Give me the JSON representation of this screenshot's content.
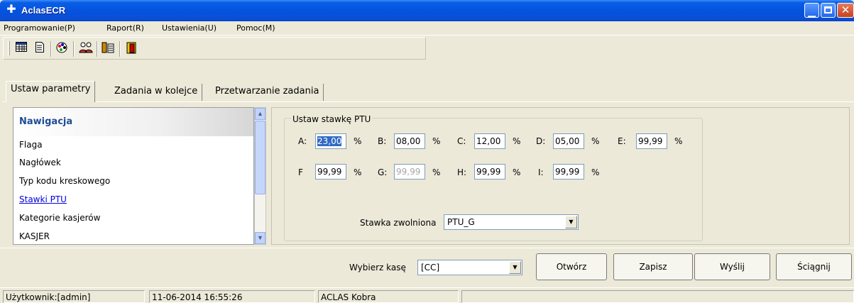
{
  "window": {
    "title": "AclasECR",
    "icon": "app-plus-icon"
  },
  "menu": [
    "Programowanie(P)",
    "Raport(R)",
    "Ustawienia(U)",
    "Pomoc(M)"
  ],
  "toolbar": {
    "icons": [
      "table-icon",
      "document-icon",
      "palette-icon",
      "people-icon",
      "database-icon",
      "exit-door-icon"
    ]
  },
  "tabs": [
    "Ustaw parametry",
    "Zadania w kolejce",
    "Przetwarzanie zadania"
  ],
  "nav": {
    "title": "Nawigacja",
    "items": [
      "Flaga",
      "Nagłówek",
      "Typ kodu kreskowego",
      "Stawki PTU",
      "Kategorie kasjerów",
      "KASJER"
    ]
  },
  "ptu": {
    "group_title": "Ustaw stawkę PTU",
    "rows": [
      [
        {
          "label": "A:",
          "value": "23,00"
        },
        {
          "label": "B:",
          "value": "08,00"
        },
        {
          "label": "C:",
          "value": "12,00"
        },
        {
          "label": "D:",
          "value": "05,00"
        },
        {
          "label": "E:",
          "value": "99,99"
        }
      ],
      [
        {
          "label": "F",
          "value": "99,99"
        },
        {
          "label": "G:",
          "value": "99,99"
        },
        {
          "label": "H:",
          "value": "99,99"
        },
        {
          "label": "I:",
          "value": "99,99"
        }
      ]
    ],
    "percent": "%",
    "exempt_label": "Stawka zwolniona",
    "exempt_value": "PTU_G"
  },
  "bottom": {
    "select_label": "Wybierz kasę",
    "select_value": "[CC]",
    "buttons": [
      "Otwórz",
      "Zapisz",
      "Wyślij",
      "Ściągnij"
    ]
  },
  "status": {
    "user": "Użytkownik:[admin]",
    "datetime": "11-06-2014 16:55:26",
    "device": "ACLAS Kobra"
  }
}
